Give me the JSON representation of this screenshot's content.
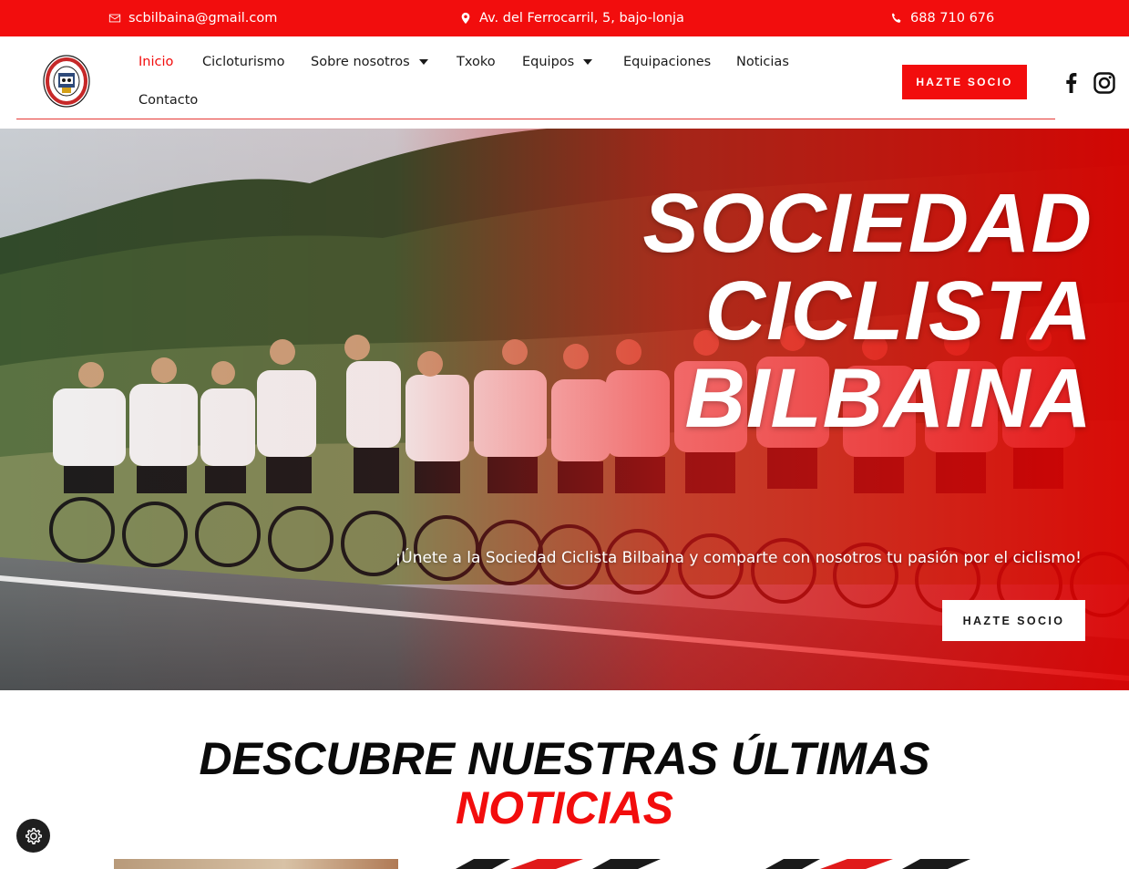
{
  "topbar": {
    "email": "scbilbaina@gmail.com",
    "address": "Av. del Ferrocarril, 5, bajo-lonja",
    "phone": "688 710 676"
  },
  "nav": {
    "items": [
      {
        "label": "Inicio",
        "active": true
      },
      {
        "label": "Cicloturismo"
      },
      {
        "label": "Sobre nosotros",
        "dropdown": true
      },
      {
        "label": "Txoko"
      },
      {
        "label": "Equipos",
        "dropdown": true
      },
      {
        "label": "Equipaciones"
      },
      {
        "label": "Noticias"
      },
      {
        "label": "Contacto"
      }
    ],
    "cta": "HAZTE SOCIO"
  },
  "hero": {
    "title_lines": [
      "SOCIEDAD",
      "CICLISTA",
      "BILBAINA"
    ],
    "subtitle": "¡Únete a la Sociedad Ciclista Bilbaina y comparte con nosotros tu pasión por el ciclismo!",
    "cta": "HAZTE SOCIO"
  },
  "news": {
    "title_line1": "DESCUBRE NUESTRAS ÚLTIMAS",
    "title_line2": "NOTICIAS"
  },
  "colors": {
    "brand_red": "#f20d0d",
    "dark": "#1a1a1a",
    "white": "#ffffff"
  },
  "icons": [
    "email-icon",
    "location-pin-icon",
    "phone-icon",
    "facebook-icon",
    "instagram-icon",
    "cookie-settings-icon"
  ]
}
